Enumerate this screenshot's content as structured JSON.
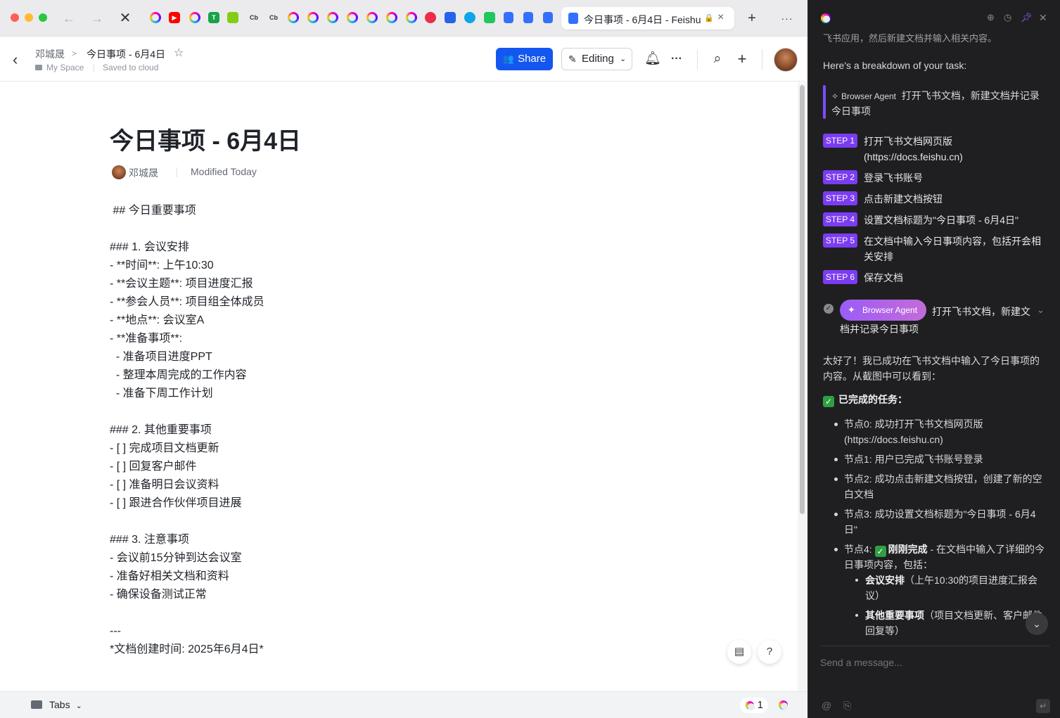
{
  "browser": {
    "active_tab_title": "今日事项 - 6月4日 - Feishu",
    "favicons": [
      "Cb",
      "Cb",
      "T"
    ],
    "new_tab": "+",
    "more": "···"
  },
  "doc_header": {
    "owner": "邓城晟",
    "crumb_sep": ">",
    "doc_name": "今日事项 - 6月4日",
    "space": "My Space",
    "save_status": "Saved to cloud",
    "share_label": "Share",
    "editing_label": "Editing"
  },
  "doc": {
    "title": "今日事项 - 6月4日",
    "author": "邓城晟",
    "modified": "Modified Today",
    "lines": [
      " ## 今日重要事项",
      "### 1. 会议安排",
      "- **时间**: 上午10:30",
      "- **会议主题**: 项目进度汇报",
      "- **参会人员**: 项目组全体成员",
      "- **地点**: 会议室A",
      "- **准备事项**:",
      "  - 准备项目进度PPT",
      "  - 整理本周完成的工作内容",
      "  - 准备下周工作计划",
      "### 2. 其他重要事项",
      "- [ ] 完成项目文档更新",
      "- [ ] 回复客户邮件",
      "- [ ] 准备明日会议资料",
      "- [ ] 跟进合作伙伴项目进展",
      "### 3. 注意事项",
      "- 会议前15分钟到达会议室",
      "- 准备好相关文档和资料",
      "- 确保设备测试正常",
      "---",
      "*文档创建时间: 2025年6月4日*"
    ]
  },
  "bottom_bar": {
    "tabs_label": "Tabs",
    "count": "1"
  },
  "panel": {
    "top_cut": "飞书应用，然后新建文档并输入相关内容。",
    "breakdown": "Here's a breakdown of your task:",
    "agent_label": "Browser Agent",
    "quote_task_1": "打开飞书文档，新建文档并记录",
    "quote_task_2": "今日事项",
    "steps": [
      {
        "tag": "STEP 1",
        "text": "打开飞书文档网页版\n(https://docs.feishu.cn)"
      },
      {
        "tag": "STEP 2",
        "text": "登录飞书账号"
      },
      {
        "tag": "STEP 3",
        "text": "点击新建文档按钮"
      },
      {
        "tag": "STEP 4",
        "text": "设置文档标题为\"今日事项 - 6月4日\""
      },
      {
        "tag": "STEP 5",
        "text": "在文档中输入今日事项内容，包括开会相\n关安排"
      },
      {
        "tag": "STEP 6",
        "text": "保存文档"
      }
    ],
    "pill_task_1": "打开飞书文档，新建文",
    "pill_task_2": "档并记录今日事项",
    "result_intro": "太好了！我已成功在飞书文档中输入了今日事项的\n内容。从截图中可以看到：",
    "done_heading": "已完成的任务：",
    "bullets": [
      "节点0: 成功打开飞书文档网页版\n(https://docs.feishu.cn)",
      "节点1: 用户已完成飞书账号登录",
      "节点2: 成功点击新建文档按钮，创建了新的空\n白文档",
      "节点3: 成功设置文档标题为\"今日事项 - 6月4\n日\""
    ],
    "node4_prefix": "节点4: ",
    "node4_bold": "刚刚完成",
    "node4_rest": " - 在文档中输入了详细的今",
    "node4_line2": "日事项内容，包括：",
    "sub1_bold": "会议安排",
    "sub1_rest": "（上午10:30的项目进度汇报会",
    "sub1_line2": "议）",
    "sub2_bold": "其他重要事项",
    "sub2_rest": "（项目文档更新、客户邮件",
    "sub2_line2": "回复等）",
    "input_placeholder": "Send a message..."
  },
  "colors": {
    "share_blue": "#1456f0",
    "step_purple": "#7b3cf2",
    "panel_bg": "#1f1f21",
    "check_green": "#2ea043"
  }
}
